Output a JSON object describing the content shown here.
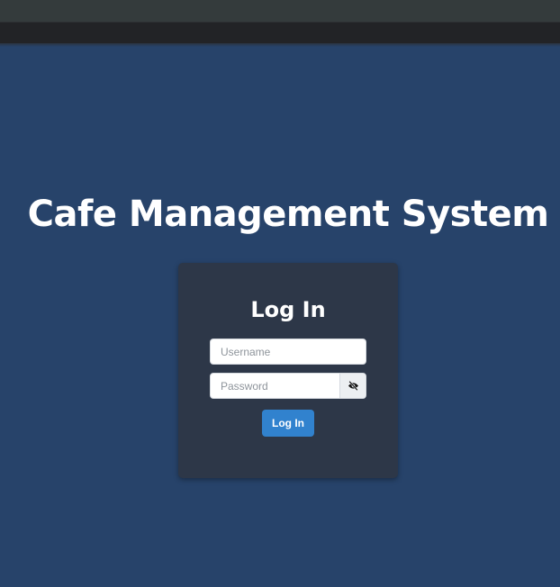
{
  "app": {
    "title": "Cafe Management System"
  },
  "login": {
    "heading": "Log In",
    "username": {
      "value": "",
      "placeholder": "Username"
    },
    "password": {
      "value": "",
      "placeholder": "Password"
    },
    "toggle_icon": "eye-slash-icon",
    "submit_label": "Log In"
  },
  "colors": {
    "page_background": "#27436a",
    "card_background": "#2d3748",
    "primary_button": "#3182ce",
    "title_text": "#ffffff"
  }
}
